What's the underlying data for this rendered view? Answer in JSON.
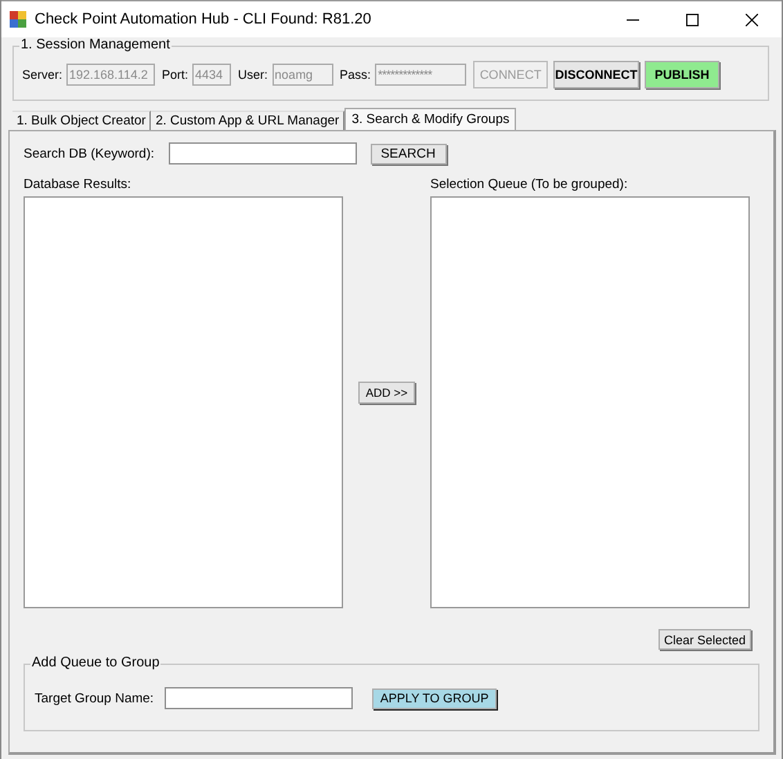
{
  "window": {
    "title": "Check Point Automation Hub - CLI Found: R81.20"
  },
  "session": {
    "title": "1. Session Management",
    "fields": [
      {
        "label": "Server:",
        "value": "192.168.114.2",
        "disabled": true
      },
      {
        "label": "Port:",
        "value": "4434",
        "disabled": true
      },
      {
        "label": "User:",
        "value": "noamg",
        "disabled": true
      },
      {
        "label": "Pass:",
        "value": "*************",
        "disabled": true
      }
    ],
    "buttons": [
      {
        "label": "CONNECT",
        "disabled": true,
        "kind": "plain"
      },
      {
        "label": "DISCONNECT",
        "disabled": false,
        "kind": "plain"
      },
      {
        "label": "PUBLISH",
        "disabled": false,
        "kind": "go"
      }
    ]
  },
  "tabs": [
    {
      "label": "1. Bulk Object Creator",
      "selected": false
    },
    {
      "label": "2. Custom App & URL Manager",
      "selected": false
    },
    {
      "label": "3. Search & Modify Groups",
      "selected": true
    }
  ],
  "search": {
    "label": "Search DB (Keyword):",
    "button": "SEARCH"
  },
  "results": {
    "label": "Database Results:"
  },
  "add_button": "ADD >>",
  "queue": {
    "label": "Selection Queue (To be grouped):"
  },
  "clear_button": "Clear Selected",
  "group": {
    "title": "Add Queue to Group",
    "label": "Target Group Name:",
    "button": "APPLY TO GROUP"
  }
}
